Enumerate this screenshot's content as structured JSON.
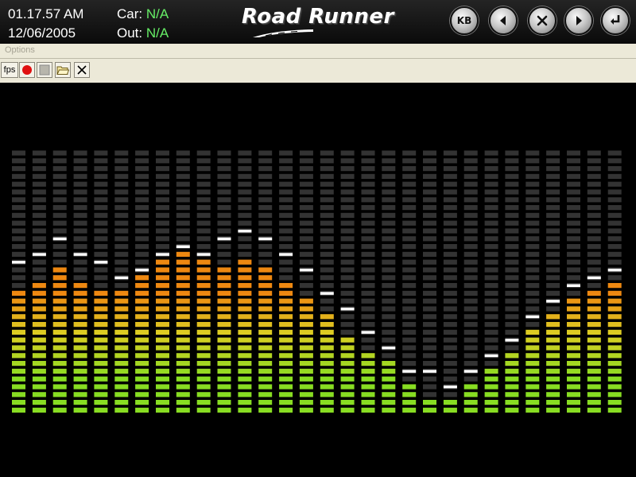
{
  "header": {
    "time": "01.17.57 AM",
    "date": "12/06/2005",
    "car_label": "Car:",
    "car_value": "N/A",
    "out_label": "Out:",
    "out_value": "N/A",
    "logo_text": "Road Runner",
    "kb_label": "KB"
  },
  "menu": {
    "options_label": "Options"
  },
  "toolbar": {
    "fps_label": "fps"
  },
  "colors": {
    "unlit_segment": "#333333",
    "peak_marker": "#ffffff",
    "low": "#88dd22",
    "mid": "#ddcc22",
    "high": "#ee8811",
    "value_text": "#66ee66"
  },
  "equalizer": {
    "segments_per_band": 34,
    "levels": [
      16,
      17,
      19,
      17,
      16,
      16,
      18,
      20,
      21,
      20,
      19,
      20,
      19,
      17,
      15,
      13,
      10,
      8,
      7,
      4,
      2,
      2,
      4,
      6,
      8,
      11,
      13,
      15,
      16,
      17
    ],
    "peaks": [
      20,
      21,
      23,
      21,
      20,
      18,
      19,
      21,
      22,
      21,
      23,
      24,
      23,
      21,
      19,
      16,
      14,
      11,
      9,
      6,
      6,
      4,
      6,
      8,
      10,
      13,
      15,
      17,
      18,
      19
    ]
  }
}
